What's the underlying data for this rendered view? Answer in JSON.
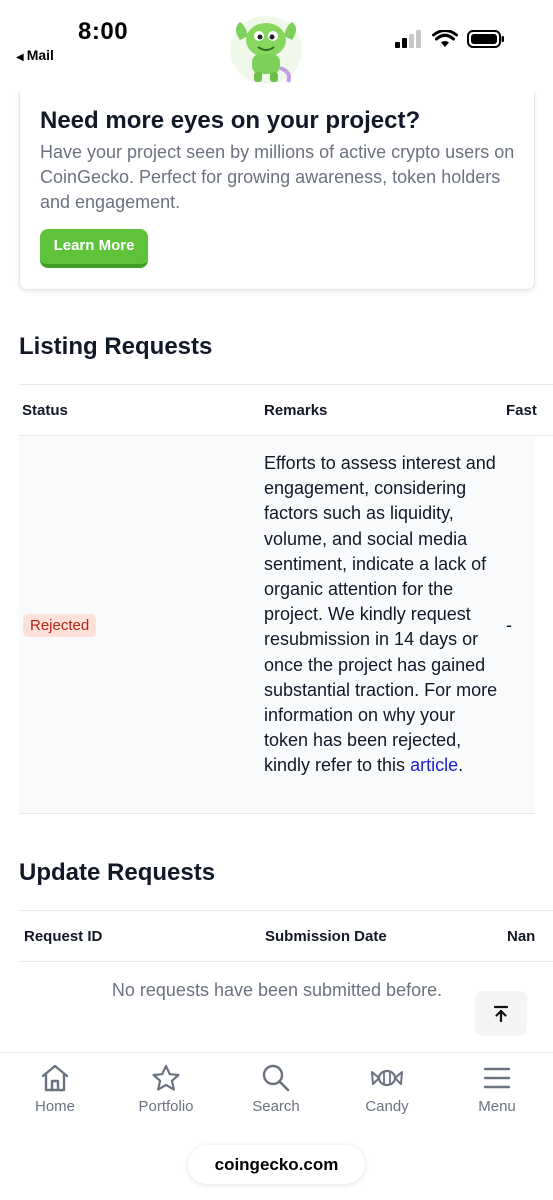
{
  "status_bar": {
    "time": "8:00",
    "back_label": "Mail"
  },
  "promo": {
    "title": "Need more eyes on your project?",
    "description": "Have your project seen by millions of active crypto users on CoinGecko. Perfect for growing awareness, token holders and engagement.",
    "button_label": "Learn More"
  },
  "listing": {
    "title": "Listing Requests",
    "columns": [
      "Status",
      "Remarks",
      "Fast"
    ],
    "rows": [
      {
        "status": "Rejected",
        "remark": "Efforts to assess interest and engagement, considering factors such as liquidity, volume, and social media sentiment, indicate a lack of organic attention for the project. We kindly request resubmission in 14 days or once the project has gained substantial traction. For more information on why your token has been rejected, kindly refer to this ",
        "remark_link": "article",
        "remark_end": ".",
        "fast": "-"
      }
    ]
  },
  "updates": {
    "title": "Update Requests",
    "columns": [
      "Request ID",
      "Submission Date",
      "Nan"
    ],
    "empty_message": "No requests have been submitted before."
  },
  "bottom_nav": {
    "items": [
      "Home",
      "Portfolio",
      "Search",
      "Candy",
      "Menu"
    ]
  },
  "url": "coingecko.com",
  "colors": {
    "accent_green": "#5ec23a",
    "rejected_bg": "#fde1d8",
    "rejected_text": "#b42318",
    "link": "#1d1fd0"
  }
}
